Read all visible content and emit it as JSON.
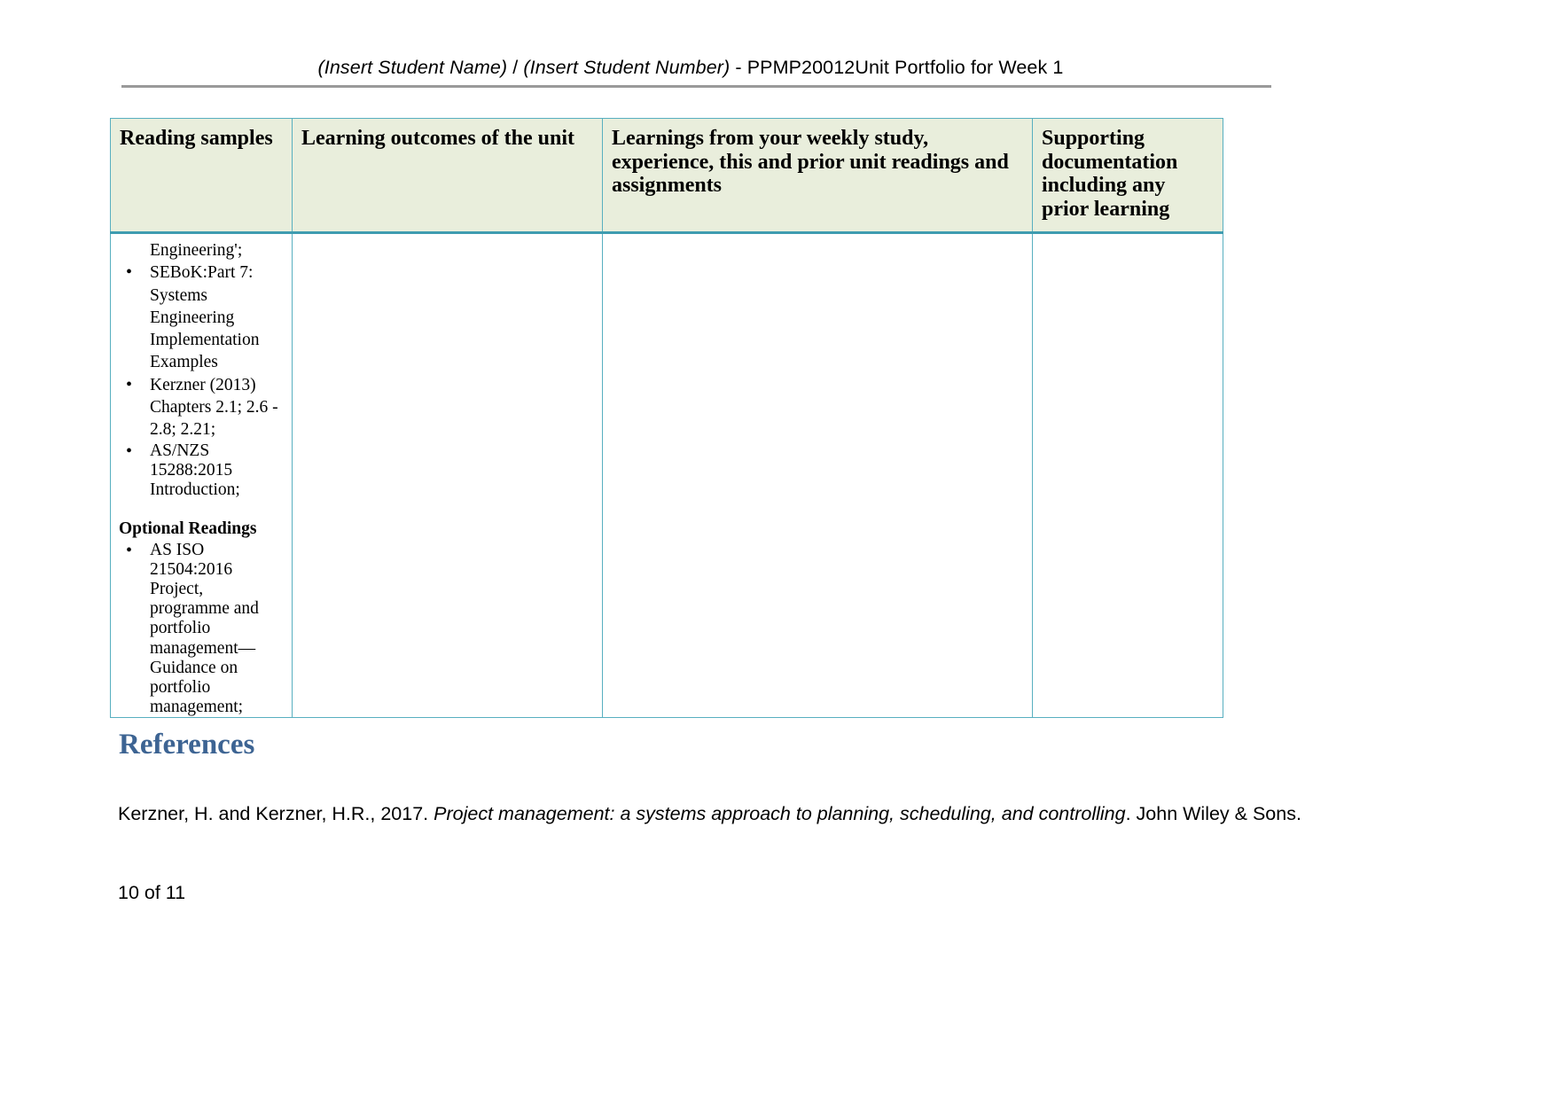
{
  "document": {
    "header": {
      "student_name_placeholder": "(Insert Student Name)",
      "separator": " / ",
      "student_number_placeholder": "(Insert Student Number)",
      "suffix": " - PPMP20012Unit Portfolio for Week 1"
    },
    "footer": {
      "page_indicator": "10 of 11"
    }
  },
  "table": {
    "headers": [
      "Reading samples",
      "Learning outcomes of the unit",
      "Learnings from your weekly study, experience, this and prior unit readings and assignments",
      "Supporting documentation including any prior learning"
    ],
    "row": {
      "reading_samples": {
        "continued_line": "Engineering';",
        "items": [
          "SEBoK:Part 7: Systems Engineering Implementation Examples",
          "Kerzner (2013) Chapters 2.1; 2.6 - 2.8; 2.21;",
          "AS/NZS 15288:2015 Introduction;"
        ],
        "optional_heading": "Optional Readings",
        "optional_items": [
          "AS ISO 21504:2016 Project, programme and portfolio management—Guidance on portfolio management;"
        ]
      },
      "learning_outcomes": "",
      "learnings_from_study": "",
      "supporting_documentation": ""
    }
  },
  "references": {
    "heading": "References",
    "entries": [
      {
        "authors_year": "Kerzner, H. and Kerzner, H.R., 2017. ",
        "title": "Project management: a systems approach to planning, scheduling, and controlling",
        "publisher": ". John Wiley & Sons."
      }
    ]
  },
  "colors": {
    "table_border": "#58afc0",
    "header_fill": "#e9eedc",
    "heading_blue": "#3d6493",
    "header_rule": "#9a9a9a"
  }
}
